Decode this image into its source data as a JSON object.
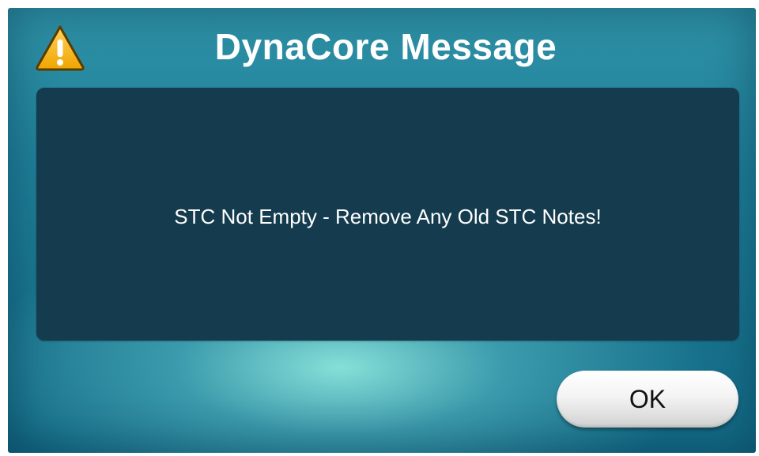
{
  "dialog": {
    "title": "DynaCore Message",
    "icon": "warning-icon",
    "message": "STC Not Empty - Remove Any Old STC Notes!",
    "ok_label": "OK"
  },
  "colors": {
    "panel_background": "#143c4e",
    "dialog_teal": "#1f7f98",
    "warning_yellow": "#f6b928",
    "text": "#ffffff"
  }
}
